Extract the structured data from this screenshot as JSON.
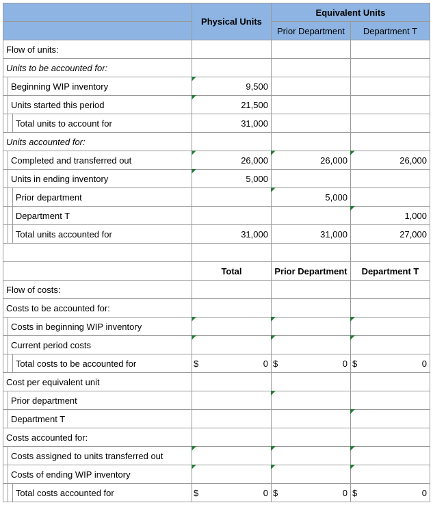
{
  "headers": {
    "physical_units": "Physical Units",
    "equivalent_units": "Equivalent Units",
    "prior_department": "Prior Department",
    "department_t": "Department T",
    "total": "Total"
  },
  "sections": {
    "flow_of_units": "Flow of units:",
    "units_to_be_accounted": "Units to be accounted for:",
    "beginning_wip": "Beginning WIP inventory",
    "units_started": "Units started this period",
    "total_units_to_account": "Total units to account for",
    "units_accounted_for": "Units accounted for:",
    "completed_transferred": "Completed and transferred out",
    "units_ending": "Units in ending inventory",
    "prior_dept": "Prior department",
    "dept_t": "Department T",
    "total_units_accounted": "Total units accounted for",
    "flow_of_costs": "Flow of costs:",
    "costs_to_be_accounted": "Costs to be accounted for:",
    "costs_beginning_wip": "Costs in beginning WIP inventory",
    "current_period_costs": "Current period costs",
    "total_costs_to_be": "Total costs to be accounted for",
    "cost_per_equiv": "Cost per equivalent unit",
    "cost_prior_dept": "Prior department",
    "cost_dept_t": "Department T",
    "costs_accounted_for": "Costs accounted for:",
    "costs_assigned": "Costs assigned to units transferred out",
    "costs_ending_wip": "Costs of ending WIP inventory",
    "total_costs_accounted": "Total costs accounted for"
  },
  "values": {
    "beginning_wip_pu": "9,500",
    "units_started_pu": "21,500",
    "total_units_to_account_pu": "31,000",
    "completed_pu": "26,000",
    "completed_pd": "26,000",
    "completed_dt": "26,000",
    "units_ending_pu": "5,000",
    "prior_dept_pd": "5,000",
    "dept_t_dt": "1,000",
    "total_units_acc_pu": "31,000",
    "total_units_acc_pd": "31,000",
    "total_units_acc_dt": "27,000",
    "zero": "0",
    "dollar": "$"
  }
}
